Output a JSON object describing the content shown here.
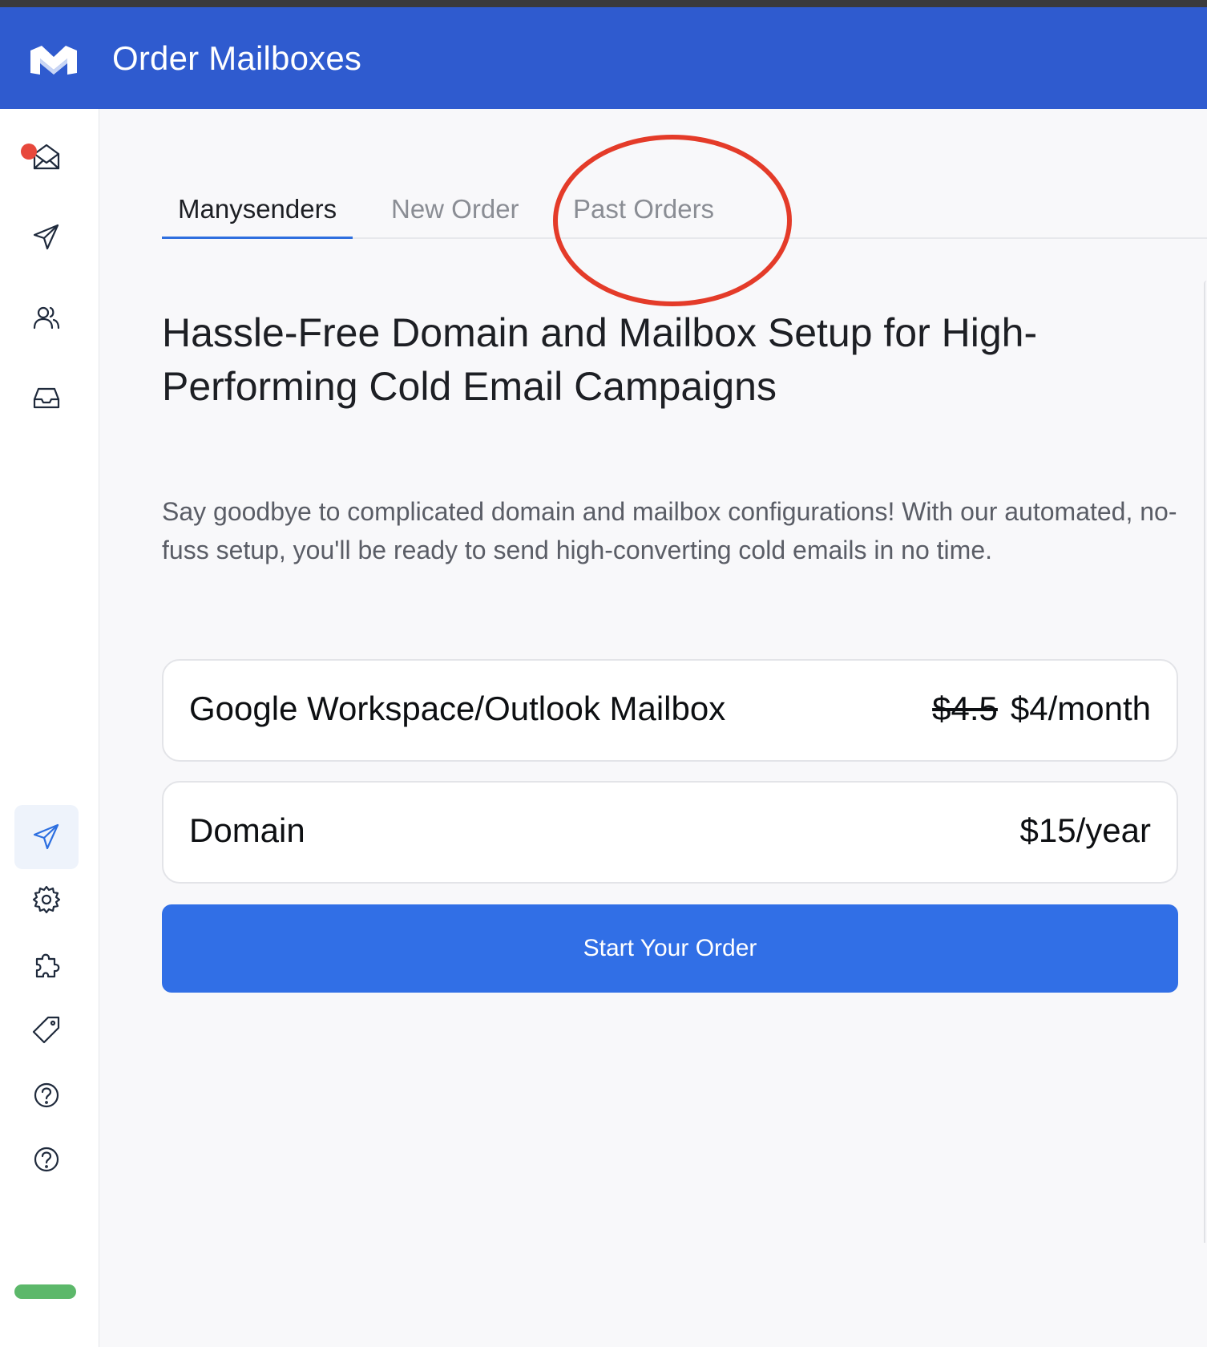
{
  "header": {
    "title": "Order Mailboxes",
    "logo_icon": "m-logo-icon",
    "background": "#2f5bcf"
  },
  "sidebar": {
    "top_items": [
      {
        "icon": "mail-envelope-icon",
        "has_notification": true
      },
      {
        "icon": "send-icon"
      },
      {
        "icon": "users-icon"
      },
      {
        "icon": "inbox-icon"
      }
    ],
    "bottom_items": [
      {
        "icon": "send-active-icon",
        "active": true
      },
      {
        "icon": "gear-icon"
      },
      {
        "icon": "puzzle-icon"
      },
      {
        "icon": "tag-icon"
      },
      {
        "icon": "help-circle-icon"
      },
      {
        "icon": "help-circle-icon"
      }
    ],
    "accent_color": "#2d6fe0",
    "notification_color": "#e7483c",
    "status_pill_color": "#5cb86a"
  },
  "tabs": [
    {
      "label": "Manysenders",
      "active": true
    },
    {
      "label": "New Order",
      "active": false
    },
    {
      "label": "Past Orders",
      "active": false
    }
  ],
  "annotation_color": "#e43b29",
  "headline": "Hassle-Free Domain and Mailbox Setup for High-Performing Cold Email Campaigns",
  "lead": "Say goodbye to complicated domain and mailbox configurations! With our automated, no-fuss setup, you'll be ready to send high-converting cold emails in no time.",
  "products": [
    {
      "label": "Google Workspace/Outlook Mailbox",
      "old_price": "$4.5",
      "price": "$4/month"
    },
    {
      "label": "Domain",
      "old_price": "",
      "price": "$15/year"
    }
  ],
  "cta": {
    "label": "Start Your Order",
    "color": "#316fe6"
  }
}
